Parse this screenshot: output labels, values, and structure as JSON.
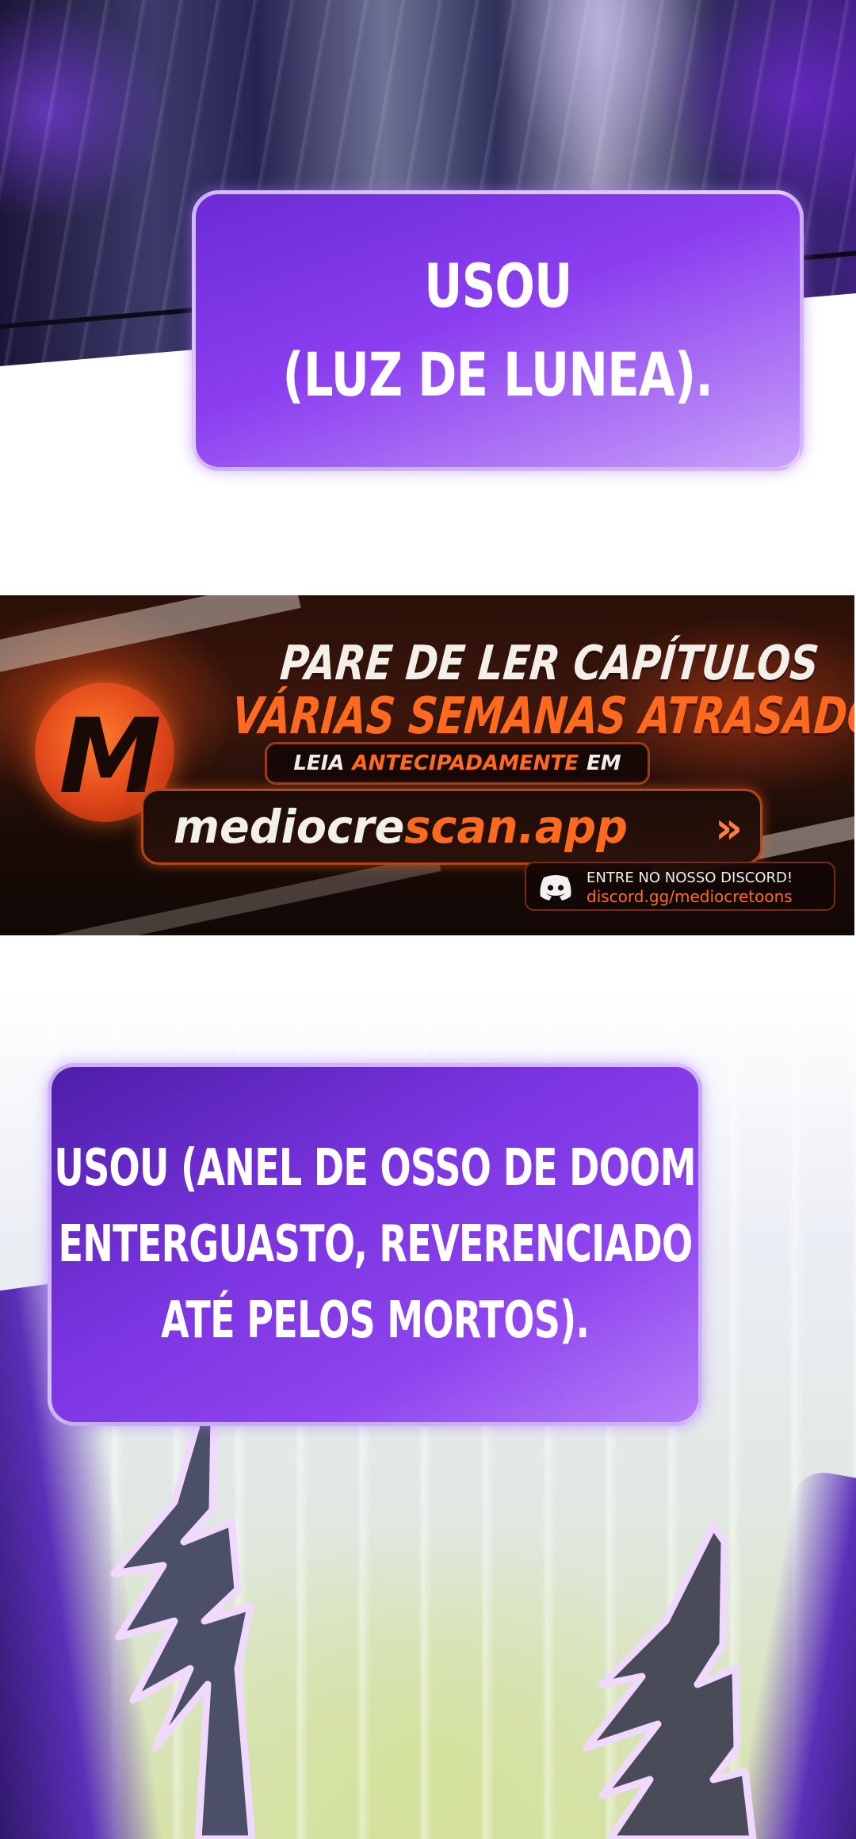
{
  "panel_1": {
    "caption_lines": [
      "USOU",
      "(LUZ DE LUNEA)."
    ]
  },
  "banner": {
    "logo_letter": "M",
    "headline_line_1": "PARE DE LER CAPÍTULOS",
    "headline_line_2": "VÁRIAS SEMANAS ATRASADO!",
    "read_prefix": "LEIA",
    "read_accent": "ANTECIPADAMENTE",
    "read_suffix": "EM",
    "url_part_1": "mediocre",
    "url_part_2": "scan.app",
    "chevron_icon": "double-chevron-right-icon",
    "discord_title": "ENTRE NO NOSSO DISCORD!",
    "discord_link": "discord.gg/mediocretoons",
    "discord_icon": "discord-icon",
    "accent_color": "#ff6a1f"
  },
  "panel_3": {
    "caption_lines": [
      "USOU (ANEL DE OSSO DE DOOM",
      "ENTERGUASTO, REVERENCIADO",
      "ATÉ PELOS MORTOS)."
    ]
  },
  "colors": {
    "caption_purple": "#8b3ef0",
    "caption_border": "#ebdcff"
  }
}
